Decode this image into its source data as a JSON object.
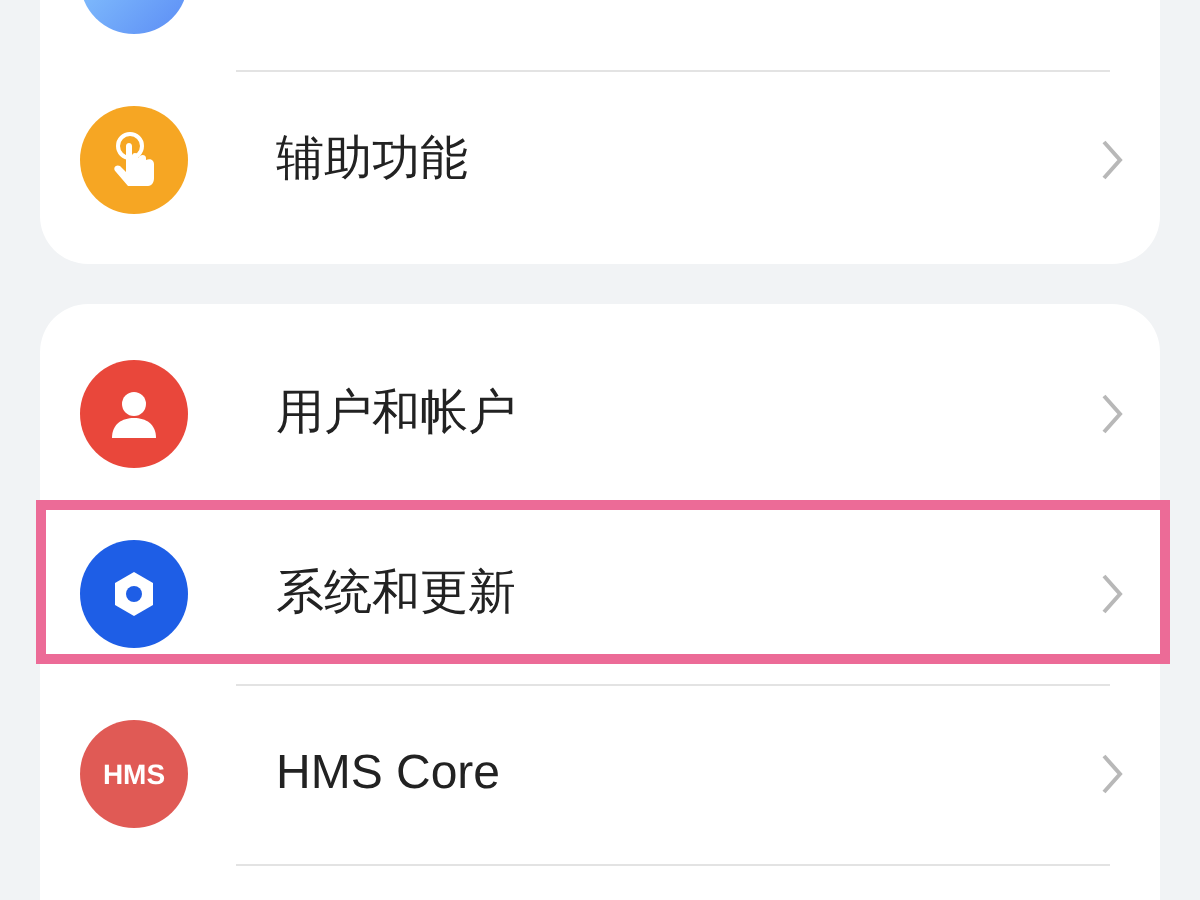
{
  "groups": [
    {
      "items": [
        {
          "kind": "blue",
          "highlighted": false
        },
        {
          "kind": "hand",
          "label": "辅助功能",
          "highlighted": false
        }
      ]
    },
    {
      "items": [
        {
          "kind": "person",
          "label": "用户和帐户",
          "highlighted": false
        },
        {
          "kind": "gear",
          "label": "系统和更新",
          "highlighted": true
        },
        {
          "kind": "hms",
          "icon_text": "HMS",
          "label": "HMS Core",
          "highlighted": false
        },
        {
          "kind": "blank",
          "highlighted": false
        }
      ]
    }
  ]
}
